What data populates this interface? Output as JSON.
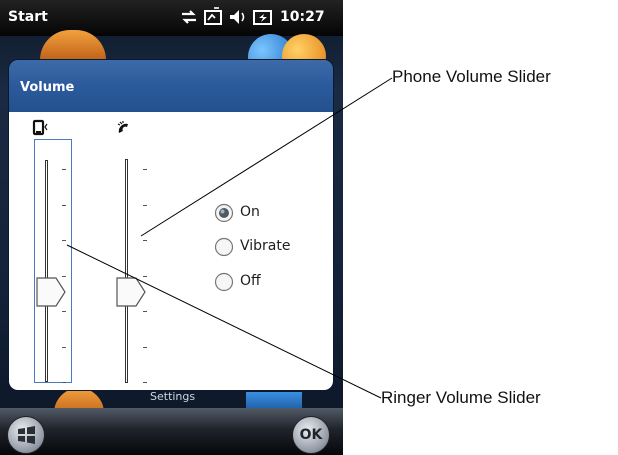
{
  "statusbar": {
    "start_label": "Start",
    "time": "10:27",
    "icons": [
      "network-sync-icon",
      "connectivity-icon",
      "speaker-icon",
      "battery-charging-icon"
    ]
  },
  "dialog": {
    "title": "Volume",
    "ringer_icon": "ringer-phone-icon",
    "phone_icon": "phone-handset-icon",
    "ringer_slider": {
      "tick_count": 7,
      "level_fraction": 0.5
    },
    "phone_slider": {
      "tick_count": 7,
      "level_fraction": 0.5
    },
    "radio_options": [
      {
        "label": "On",
        "selected": true
      },
      {
        "label": "Vibrate",
        "selected": false
      },
      {
        "label": "Off",
        "selected": false
      }
    ]
  },
  "background": {
    "settings_label": "Settings"
  },
  "softkeys": {
    "windows_button": "windows-logo-icon",
    "ok_label": "OK"
  },
  "callouts": {
    "phone_volume_slider": "Phone Volume Slider",
    "ringer_volume_slider": "Ringer Volume Slider"
  },
  "colors": {
    "dialog_header": "#2b5a9c",
    "selection_frame": "#4a7abf",
    "statusbar": "#000000"
  }
}
